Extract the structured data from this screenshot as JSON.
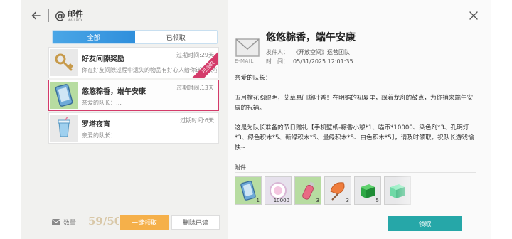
{
  "header": {
    "title": "邮件",
    "subtitle": "MAILBOX"
  },
  "tabs": [
    {
      "label": "全部",
      "active": true
    },
    {
      "label": "已领取",
      "active": false
    }
  ],
  "mails": [
    {
      "title": "好友间隙奖励",
      "preview": "你在好友间隙过程中遗失的物品有好心人给你送回来啦！",
      "expire": "过期时间:29天",
      "icon": "key-icon",
      "selected": false,
      "ribbon": "已领取"
    },
    {
      "title": "悠悠粽香，端午安康",
      "preview": "亲爱的队长：…",
      "expire": "过期时间:13天",
      "icon": "phone-card-icon",
      "selected": true,
      "ribbon": ""
    },
    {
      "title": "罗塔夜宵",
      "preview": "亲爱的队长：…",
      "expire": "过期时间:6天",
      "icon": "drink-cup-icon",
      "selected": false,
      "ribbon": ""
    }
  ],
  "footer": {
    "qty_label": "数量",
    "qty_value": "59/500",
    "claim_all": "一键领取",
    "delete_read": "删除已读"
  },
  "detail": {
    "email_caption": "E-MAIL",
    "title": "悠悠粽香，端午安康",
    "sender_label": "发件人：",
    "sender": "《开放空间》运营团队",
    "time_label": "时　间：",
    "time": "05/31/2025 12:01:35",
    "body": [
      "亲爱的队长：",
      "五月榴花照眼明，艾草悬门粽叶香！在明媚的初夏里，踩着龙舟的鼓点，为你捎来端午安康的祝福。",
      "这是为队长准备的节日赠礼【手机壁纸-粽香小憩*1、喵币*10000、染色剂*3、孔明灯*3、绿色积木*5、新绿积木*5、量绿积木*5、白色积木*5】，请及时领取。祝队长游戏愉快~"
    ],
    "attachments_label": "附件",
    "attachments": [
      {
        "icon": "phone-card-icon",
        "count": "1",
        "style": "green"
      },
      {
        "icon": "coin-icon",
        "count": "10000",
        "style": "lilac"
      },
      {
        "icon": "dye-bottle-icon",
        "count": "3",
        "style": "green"
      },
      {
        "icon": "lantern-icon",
        "count": "3",
        "style": "plain"
      },
      {
        "icon": "green-block-icon",
        "count": "5",
        "style": "plain"
      },
      {
        "icon": "mint-block-icon",
        "count": "",
        "style": "plain"
      }
    ],
    "claim_label": "领取"
  }
}
